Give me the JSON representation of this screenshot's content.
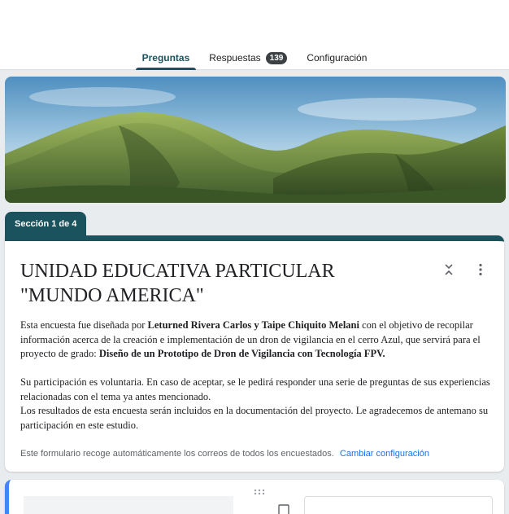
{
  "tabs": [
    {
      "label": "Preguntas",
      "active": true
    },
    {
      "label": "Respuestas",
      "badge": "139"
    },
    {
      "label": "Configuración"
    }
  ],
  "section": {
    "label": "Sección 1 de 4"
  },
  "form": {
    "title": "UNIDAD EDUCATIVA PARTICULAR \"MUNDO AMERICA\"",
    "description": {
      "p1_a": "Esta encuesta fue diseñada por ",
      "p1_b": "Leturned Rivera Carlos y Taipe Chiquito Melani",
      "p1_c": " con el objetivo de recopilar información acerca de la creación e implementación de un dron de vigilancia en el cerro Azul, que servirá para el proyecto de grado: ",
      "p1_d": "Diseño de un Prototipo de Dron de Vigilancia con Tecnología FPV.",
      "p2": "Su participación es voluntaria. En caso de aceptar, se le pedirá responder una serie de preguntas de sus experiencias relacionadas con el tema ya antes mencionado.",
      "p3": "Los resultados de esta encuesta serán incluidos en la documentación del proyecto. Le agradecemos de antemano su participación en este estudio."
    },
    "email_note": "Este formulario recoge automáticamente los correos de todos los encuestados.",
    "email_link": "Cambiar configuración"
  },
  "colors": {
    "theme": "#1a535e",
    "link": "#1a73e8",
    "question_accent": "#4285f4",
    "background": "#e8ecef"
  },
  "icons": {
    "collapse": "collapse-icon",
    "more": "more-vert-icon",
    "drag": "drag-handle-icon",
    "image": "image-icon"
  }
}
